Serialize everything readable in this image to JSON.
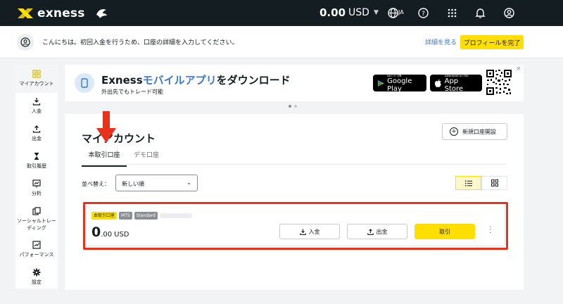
{
  "topbar": {
    "brand": "exness",
    "balance_amount": "0.00",
    "balance_currency": "USD",
    "language": "JA",
    "icons": [
      "globe-icon",
      "help-icon",
      "apps-grid-icon",
      "bell-icon",
      "profile-icon"
    ]
  },
  "notice": {
    "message": "こんにちは。初回入金を行うため、口座の詳細を入力してください。",
    "details_link": "詳細を見る",
    "complete_button": "プロフィールを完了"
  },
  "sidebar": {
    "items": [
      {
        "label": "マイアカウント",
        "icon": "dashboard-icon",
        "active": true
      },
      {
        "label": "入金",
        "icon": "deposit-icon"
      },
      {
        "label": "出金",
        "icon": "withdraw-icon"
      },
      {
        "label": "取引履歴",
        "icon": "hourglass-icon"
      },
      {
        "label": "分析",
        "icon": "analytics-icon"
      },
      {
        "label": "ソーシャルトレーディング",
        "icon": "social-trading-icon"
      },
      {
        "label": "パフォーマンス",
        "icon": "performance-icon"
      },
      {
        "label": "設定",
        "icon": "gear-icon"
      }
    ]
  },
  "banner": {
    "title_prefix": "Exness",
    "title_highlight": "モバイルアプリ",
    "title_suffix": "をダウンロード",
    "subtitle": "外出先でもトレード可能",
    "google_small": "GET IT ON",
    "google_big": "Google Play",
    "apple_small": "Download on the",
    "apple_big": "App Store",
    "close": "×"
  },
  "accounts": {
    "heading": "マイアカウント",
    "new_account_button": "新規口座開設",
    "tabs": [
      {
        "label": "本取引口座",
        "active": true
      },
      {
        "label": "デモ口座",
        "active": false
      }
    ],
    "sort_label": "並べ替え：",
    "sort_value": "新しい順",
    "account": {
      "badges": [
        "本取引口座",
        "MT5",
        "Standard"
      ],
      "balance_int": "0",
      "balance_dec": ".00",
      "currency": "USD",
      "deposit_button": "入金",
      "withdraw_button": "出金",
      "trade_button": "取引"
    }
  },
  "colors": {
    "topbar_bg": "#141d22",
    "accent_yellow": "#ffde02",
    "link_blue": "#3b78ce",
    "annotation_red": "#e8321c"
  }
}
